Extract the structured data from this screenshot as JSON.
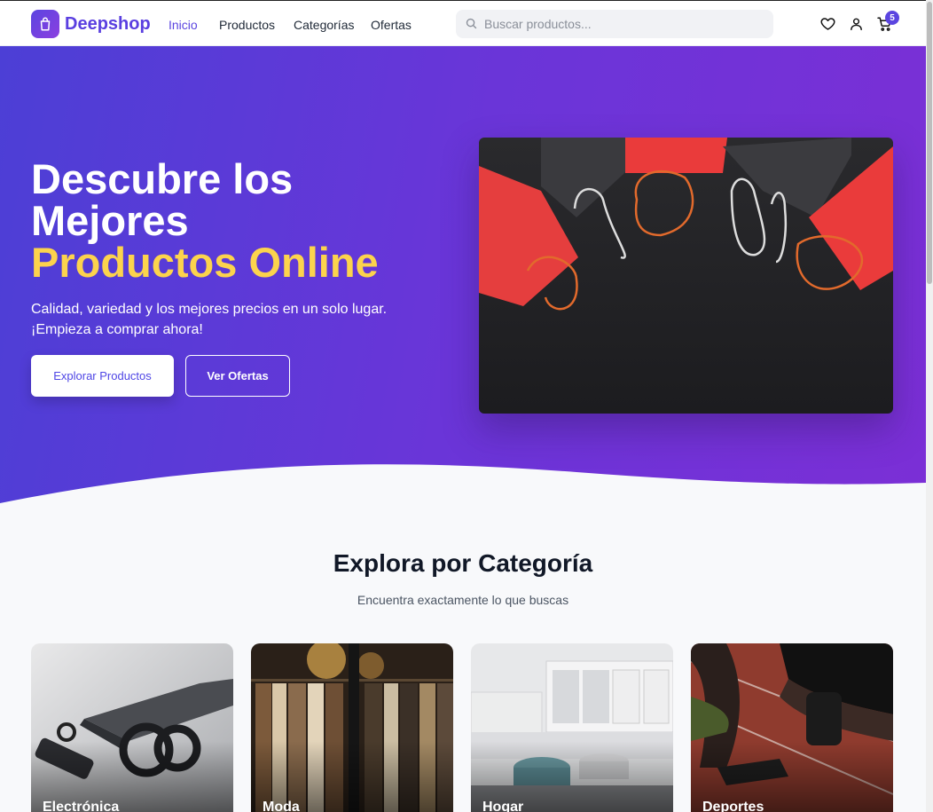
{
  "header": {
    "brand": "Deepshop",
    "nav": [
      {
        "label": "Inicio"
      },
      {
        "label": "Productos"
      },
      {
        "label": "Categorías"
      },
      {
        "label": "Ofertas"
      }
    ],
    "search_placeholder": "Buscar productos...",
    "cart_count": "5",
    "icons": [
      "shopping-bag-icon",
      "search-icon",
      "heart-icon",
      "user-icon",
      "cart-icon"
    ]
  },
  "hero": {
    "title_line1": "Descubre los",
    "title_line2": "Mejores",
    "title_accent": "Productos Online",
    "subtitle": "Calidad, variedad y los mejores precios en un solo lugar. ¡Empieza a comprar ahora!",
    "primary_button": "Explorar Productos",
    "secondary_button": "Ver Ofertas"
  },
  "categories": {
    "title": "Explora por Categoría",
    "subtitle": "Encuentra exactamente lo que buscas",
    "items": [
      {
        "label": "Electrónica"
      },
      {
        "label": "Moda"
      },
      {
        "label": "Hogar"
      },
      {
        "label": "Deportes"
      }
    ]
  },
  "colors": {
    "brand": "#5b45e0",
    "hero_gradient_start": "#4c3fd6",
    "hero_gradient_end": "#7b2fd6",
    "accent_yellow": "#fcd34d"
  }
}
